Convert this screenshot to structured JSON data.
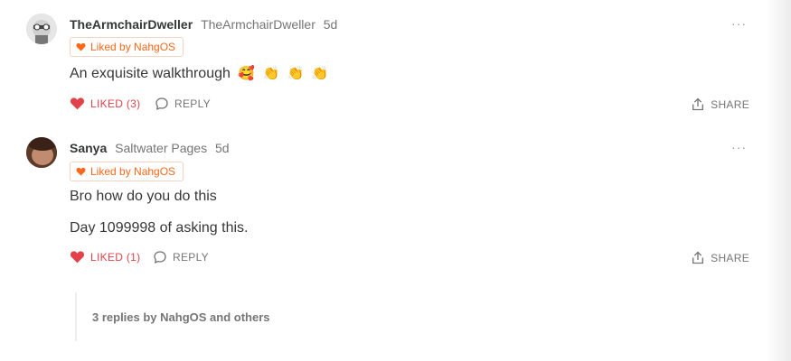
{
  "comments": [
    {
      "author": "TheArmchairDweller",
      "publication": "TheArmchairDweller",
      "time": "5d",
      "badge": "Liked by NahgOS",
      "text": [
        "An exquisite walkthrough"
      ],
      "emojis": [
        "🥰",
        "👏",
        "👏",
        "👏"
      ],
      "like_label": "LIKED (3)",
      "reply_label": "REPLY",
      "share_label": "SHARE",
      "menu": "···"
    },
    {
      "author": "Sanya",
      "publication": "Saltwater Pages",
      "time": "5d",
      "badge": "Liked by NahgOS",
      "text": [
        "Bro how do you do this",
        "Day 1099998 of asking this."
      ],
      "like_label": "LIKED (1)",
      "reply_label": "REPLY",
      "share_label": "SHARE",
      "menu": "···"
    }
  ],
  "replies_summary": "3 replies by NahgOS and others",
  "colors": {
    "accent": "#ff6719",
    "liked": "#e2434b",
    "muted": "#757575",
    "text": "#363737"
  }
}
